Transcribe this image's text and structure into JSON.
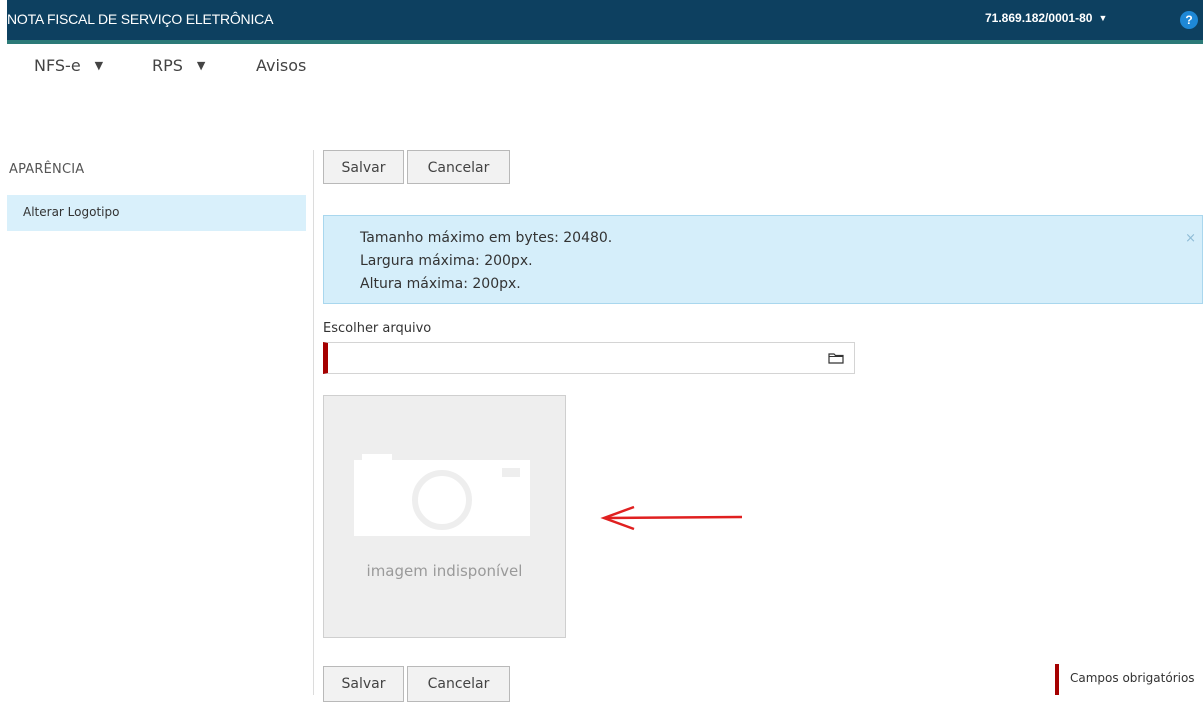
{
  "header": {
    "title": "NOTA FISCAL DE SERVIÇO ELETRÔNICA",
    "account": "71.869.182/0001-80",
    "help_label": "?",
    "bar_color": "#0d4060",
    "accent_color": "#2b7a78"
  },
  "nav": {
    "items": [
      {
        "label": "NFS-e",
        "has_dropdown": true
      },
      {
        "label": "RPS",
        "has_dropdown": true
      },
      {
        "label": "Avisos",
        "has_dropdown": false
      }
    ]
  },
  "sidebar": {
    "section_title": "APARÊNCIA",
    "items": [
      {
        "label": "Alterar Logotipo",
        "selected": true
      }
    ]
  },
  "toolbar_top": {
    "save_label": "Salvar",
    "cancel_label": "Cancelar"
  },
  "info_alert": {
    "lines": [
      "Tamanho máximo em bytes: 20480.",
      "Largura máxima: 200px.",
      "Altura máxima: 200px."
    ],
    "close_label": "×"
  },
  "file_field": {
    "label": "Escolher arquivo",
    "value": "",
    "icon": "folder-icon",
    "required": true
  },
  "image_placeholder": {
    "caption": "imagem indisponível",
    "icon": "camera-icon"
  },
  "toolbar_bottom": {
    "save_label": "Salvar",
    "cancel_label": "Cancelar"
  },
  "legend": {
    "required_label": "Campos obrigatórios",
    "required_color": "#a50000"
  },
  "annotation": {
    "arrow_color": "#e02020"
  }
}
